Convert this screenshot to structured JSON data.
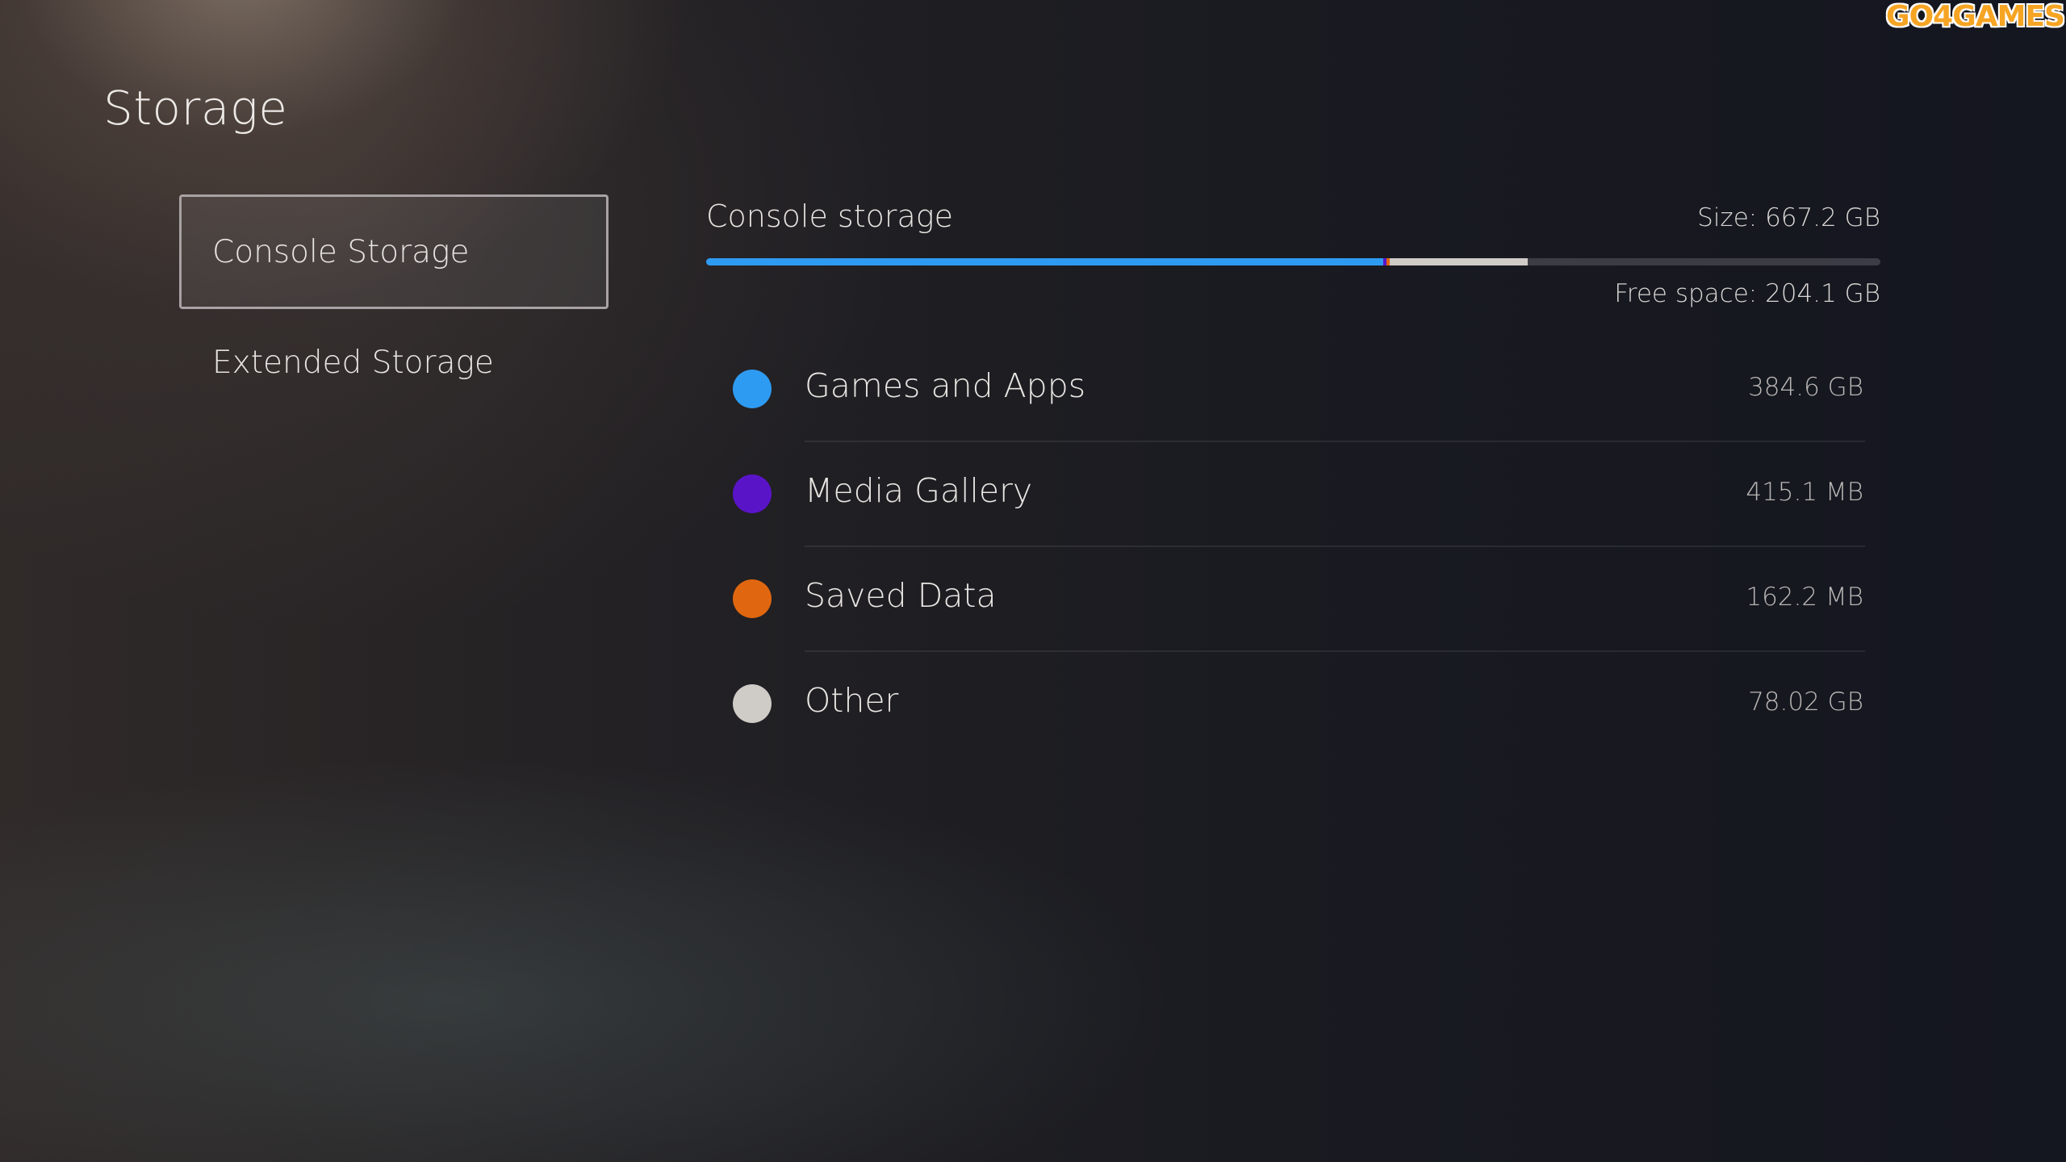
{
  "page": {
    "title": "Storage",
    "watermark": "GO4GAMES"
  },
  "sidebar": {
    "items": [
      {
        "label": "Console Storage",
        "selected": true
      },
      {
        "label": "Extended Storage",
        "selected": false
      }
    ]
  },
  "console_storage": {
    "title": "Console storage",
    "size_text": "Size: 667.2 GB",
    "free_space_text": "Free space: 204.1 GB",
    "usage_bar": {
      "total_gb": 667.2,
      "segments": [
        {
          "name": "Games and Apps",
          "gb": 384.6,
          "color": "#2e9bf2"
        },
        {
          "name": "Media Gallery",
          "gb": 0.4151,
          "color": "#5a14c8"
        },
        {
          "name": "Saved Data",
          "gb": 0.1622,
          "color": "#e0660f"
        },
        {
          "name": "Other",
          "gb": 78.02,
          "color": "#cfcbc6"
        }
      ],
      "free_color": "#3b3c44"
    },
    "categories": [
      {
        "label": "Games and Apps",
        "size": "384.6 GB",
        "color": "#2e9bf2"
      },
      {
        "label": "Media Gallery",
        "size": "415.1 MB",
        "color": "#5a14c8"
      },
      {
        "label": "Saved Data",
        "size": "162.2 MB",
        "color": "#e0660f"
      },
      {
        "label": "Other",
        "size": "78.02 GB",
        "color": "#cfcbc6"
      }
    ]
  }
}
